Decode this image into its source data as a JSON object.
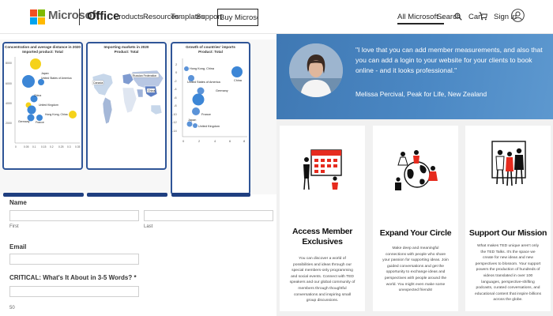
{
  "header": {
    "brand": "Microsoft",
    "product": "Office",
    "nav": [
      "Products",
      "Resources",
      "Templates",
      "Support"
    ],
    "buy_button": "Buy Microsoft 365",
    "all_microsoft": "All Microsoft",
    "search": "Search",
    "cart": "Cart",
    "sign_in": "Sign in",
    "logo_colors": [
      "#f25022",
      "#7fba00",
      "#00a4ef",
      "#ffb900"
    ]
  },
  "charts": {
    "bubble": {
      "title_line1": "Concentration and average distance in 2020",
      "title_line2": "Imported product: Total",
      "y_ticks": [
        "8000",
        "6000",
        "4000",
        "2000"
      ],
      "x_ticks": [
        "0",
        "0.05",
        "0.1",
        "0.15",
        "0.2",
        "0.25",
        "0.3",
        "0.35"
      ],
      "labels": [
        "Japan",
        "United States of America",
        "China",
        "United Kingdom",
        "Germany",
        "France",
        "Hong Kong, China"
      ]
    },
    "map": {
      "title_line1": "Importing markets in 2020",
      "title_line2": "Product: Total",
      "labels": [
        "Canada",
        "Russian Federation",
        "China"
      ]
    },
    "growth": {
      "title_line1": "Growth of countries' imports",
      "title_line2": "Product: Total",
      "y_ticks": [
        "2",
        "0",
        "-2",
        "-4",
        "-6",
        "-8",
        "-10",
        "-12",
        "-14"
      ],
      "x_ticks": [
        "0",
        "2",
        "4",
        "6",
        "8"
      ],
      "labels": [
        "Hong Kong, China",
        "United States of America",
        "Germany",
        "France",
        "Japan",
        "United Kingdom",
        "China"
      ]
    }
  },
  "form": {
    "name_label": "Name",
    "first_sub": "First",
    "last_sub": "Last",
    "email_label": "Email",
    "critical_label": "CRITICAL: What's It About in 3-5 Words? *",
    "counter": "50"
  },
  "testimonial": {
    "quote": "\"I love that you can add member measurements, and also that you can add a login to your website for your clients to book online - and it looks professional.\"",
    "author": "Melissa Percival, Peak for Life, New Zealand"
  },
  "cards": [
    {
      "title": "Access Member Exclusives",
      "text": "You can discover a world of possibilities and ideas through our special members-only programming and social events. Connect with TED speakers and our global community of members through thoughtful conversations and inspiring small group discussions.",
      "icon": "calendar-people-illustration"
    },
    {
      "title": "Expand Your Circle",
      "text": "Make deep and meaningful connections with people who share your passion for supporting ideas. Join guided conversations and get the opportunity to exchange ideas and perspectives with people around the world. You might even make some unexpected friends!",
      "icon": "globe-people-illustration"
    },
    {
      "title": "Support Our Mission",
      "text": "What makes TED unique aren't only the TED Talks. It's the space we create for new ideas and new perspectives to blossom. Your support powers the production of hundreds of videos translated in over 100 languages, perspective-shifting podcasts, curated conversations, and educational content that inspire billions across the globe.",
      "icon": "portrait-people-illustration"
    }
  ],
  "colors": {
    "accent_red": "#e62b1e",
    "header_blue": "#4a86c3",
    "chart_border": "#2f5597"
  }
}
